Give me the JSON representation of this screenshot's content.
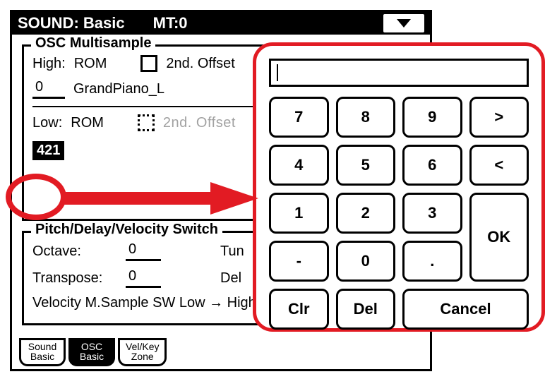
{
  "title": {
    "sound_label": "SOUND:",
    "sound_name": "Basic",
    "mt_label": "MT:",
    "mt_value": "0"
  },
  "osc": {
    "legend": "OSC Multisample",
    "high_label": "High:",
    "high_source": "ROM",
    "offset2_label": "2nd. Offset",
    "high_index": "0",
    "high_name": "GrandPiano_L",
    "low_label": "Low:",
    "low_source": "ROM",
    "offset2_label_dim": "2nd. Offset",
    "low_index": "421"
  },
  "pitch": {
    "legend": "Pitch/Delay/Velocity Switch",
    "octave_label": "Octave:",
    "octave_value": "0",
    "tune_partial": "Tun",
    "transpose_label": "Transpose:",
    "transpose_value": "0",
    "delay_partial": "Del",
    "vsw_text": "Velocity M.Sample SW Low → High"
  },
  "tabs": {
    "t0a": "Sound",
    "t0b": "Basic",
    "t1a": "OSC",
    "t1b": "Basic",
    "t2a": "Vel/Key",
    "t2b": "Zone"
  },
  "keypad": {
    "display": "",
    "k7": "7",
    "k8": "8",
    "k9": "9",
    "kgt": ">",
    "k4": "4",
    "k5": "5",
    "k6": "6",
    "klt": "<",
    "k1": "1",
    "k2": "2",
    "k3": "3",
    "kok": "OK",
    "kminus": "-",
    "k0": "0",
    "kdot": ".",
    "kclr": "Clr",
    "kdel": "Del",
    "kcancel": "Cancel"
  }
}
